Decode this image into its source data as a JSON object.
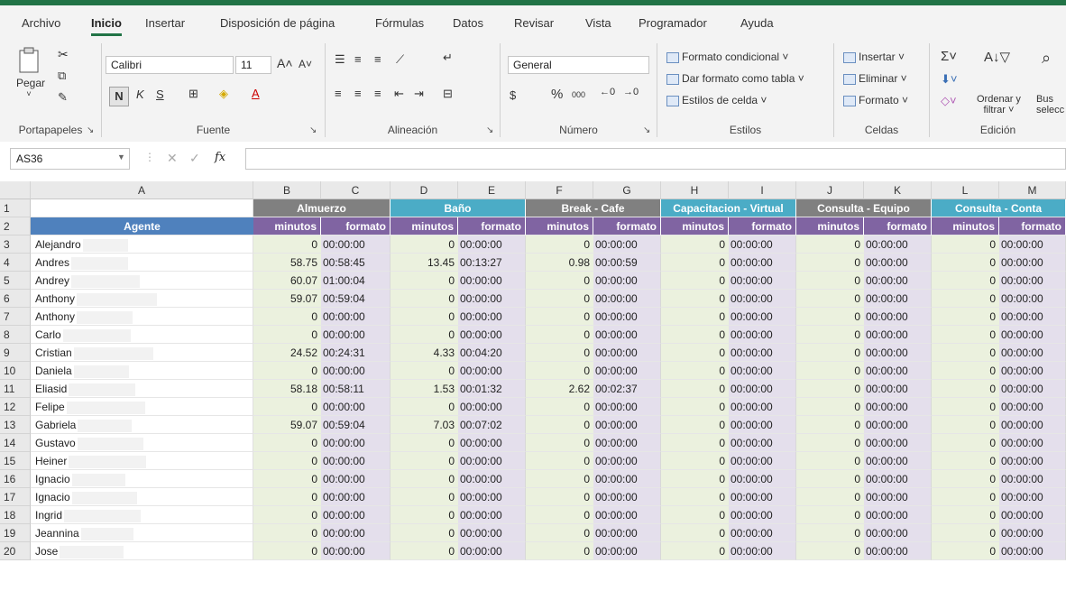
{
  "tabs": [
    "Archivo",
    "Inicio",
    "Insertar",
    "Disposición de página",
    "Fórmulas",
    "Datos",
    "Revisar",
    "Vista",
    "Programador",
    "Ayuda"
  ],
  "ribbon": {
    "portapapeles": {
      "label": "Portapapeles",
      "paste": "Pegar"
    },
    "fuente": {
      "label": "Fuente",
      "font_name": "Calibri",
      "font_size": "11",
      "bold": "N",
      "italic": "K",
      "underline": "S"
    },
    "alineacion": {
      "label": "Alineación"
    },
    "numero": {
      "label": "Número",
      "format": "General",
      "currency": "$",
      "percent": "%",
      "thousands": "000"
    },
    "estilos": {
      "label": "Estilos",
      "items": [
        "Formato condicional ˅",
        "Dar formato como tabla ˅",
        "Estilos de celda ˅"
      ]
    },
    "celdas": {
      "label": "Celdas",
      "items": [
        "Insertar ˅",
        "Eliminar ˅",
        "Formato ˅"
      ]
    },
    "edicion": {
      "label": "Edición",
      "sort_line1": "Ordenar y",
      "sort_line2": "filtrar ˅",
      "find_line1": "Bus",
      "find_line2": "selecc"
    }
  },
  "formula_bar": {
    "name_box": "AS36",
    "fx": "fx",
    "content": ""
  },
  "columns": [
    "A",
    "B",
    "C",
    "D",
    "E",
    "F",
    "G",
    "H",
    "I",
    "J",
    "K",
    "L",
    "M"
  ],
  "group_headers": [
    "Almuerzo",
    "Baño",
    "Break - Cafe",
    "Capacitacion - Virtual",
    "Consulta - Equipo",
    "Consulta - Conta"
  ],
  "agent_header": "Agente",
  "sub_headers": {
    "min": "minutos",
    "fmt": "formato"
  },
  "colors": {
    "group_header_gray": "#808080",
    "group_header_teal": "#4bacc6",
    "agente_header": "#4f81bd",
    "sub_header": "#8064a2",
    "data_green": "#ebf1de",
    "data_purple": "#e4dfec",
    "excel_green": "#217346"
  },
  "rows": [
    {
      "n": "3",
      "agent": "Alejandro",
      "vals": [
        [
          "0",
          "00:00:00"
        ],
        [
          "0",
          "00:00:00"
        ],
        [
          "0",
          "00:00:00"
        ],
        [
          "0",
          "00:00:00"
        ],
        [
          "0",
          "00:00:00"
        ],
        [
          "0",
          "00:00:00"
        ]
      ]
    },
    {
      "n": "4",
      "agent": "Andres",
      "vals": [
        [
          "58.75",
          "00:58:45"
        ],
        [
          "13.45",
          "00:13:27"
        ],
        [
          "0.98",
          "00:00:59"
        ],
        [
          "0",
          "00:00:00"
        ],
        [
          "0",
          "00:00:00"
        ],
        [
          "0",
          "00:00:00"
        ]
      ]
    },
    {
      "n": "5",
      "agent": "Andrey",
      "vals": [
        [
          "60.07",
          "01:00:04"
        ],
        [
          "0",
          "00:00:00"
        ],
        [
          "0",
          "00:00:00"
        ],
        [
          "0",
          "00:00:00"
        ],
        [
          "0",
          "00:00:00"
        ],
        [
          "0",
          "00:00:00"
        ]
      ]
    },
    {
      "n": "6",
      "agent": "Anthony",
      "vals": [
        [
          "59.07",
          "00:59:04"
        ],
        [
          "0",
          "00:00:00"
        ],
        [
          "0",
          "00:00:00"
        ],
        [
          "0",
          "00:00:00"
        ],
        [
          "0",
          "00:00:00"
        ],
        [
          "0",
          "00:00:00"
        ]
      ]
    },
    {
      "n": "7",
      "agent": "Anthony",
      "vals": [
        [
          "0",
          "00:00:00"
        ],
        [
          "0",
          "00:00:00"
        ],
        [
          "0",
          "00:00:00"
        ],
        [
          "0",
          "00:00:00"
        ],
        [
          "0",
          "00:00:00"
        ],
        [
          "0",
          "00:00:00"
        ]
      ]
    },
    {
      "n": "8",
      "agent": "Carlo",
      "vals": [
        [
          "0",
          "00:00:00"
        ],
        [
          "0",
          "00:00:00"
        ],
        [
          "0",
          "00:00:00"
        ],
        [
          "0",
          "00:00:00"
        ],
        [
          "0",
          "00:00:00"
        ],
        [
          "0",
          "00:00:00"
        ]
      ]
    },
    {
      "n": "9",
      "agent": "Cristian",
      "vals": [
        [
          "24.52",
          "00:24:31"
        ],
        [
          "4.33",
          "00:04:20"
        ],
        [
          "0",
          "00:00:00"
        ],
        [
          "0",
          "00:00:00"
        ],
        [
          "0",
          "00:00:00"
        ],
        [
          "0",
          "00:00:00"
        ]
      ]
    },
    {
      "n": "10",
      "agent": "Daniela",
      "vals": [
        [
          "0",
          "00:00:00"
        ],
        [
          "0",
          "00:00:00"
        ],
        [
          "0",
          "00:00:00"
        ],
        [
          "0",
          "00:00:00"
        ],
        [
          "0",
          "00:00:00"
        ],
        [
          "0",
          "00:00:00"
        ]
      ]
    },
    {
      "n": "11",
      "agent": "Eliasid",
      "vals": [
        [
          "58.18",
          "00:58:11"
        ],
        [
          "1.53",
          "00:01:32"
        ],
        [
          "2.62",
          "00:02:37"
        ],
        [
          "0",
          "00:00:00"
        ],
        [
          "0",
          "00:00:00"
        ],
        [
          "0",
          "00:00:00"
        ]
      ]
    },
    {
      "n": "12",
      "agent": "Felipe",
      "vals": [
        [
          "0",
          "00:00:00"
        ],
        [
          "0",
          "00:00:00"
        ],
        [
          "0",
          "00:00:00"
        ],
        [
          "0",
          "00:00:00"
        ],
        [
          "0",
          "00:00:00"
        ],
        [
          "0",
          "00:00:00"
        ]
      ]
    },
    {
      "n": "13",
      "agent": "Gabriela",
      "vals": [
        [
          "59.07",
          "00:59:04"
        ],
        [
          "7.03",
          "00:07:02"
        ],
        [
          "0",
          "00:00:00"
        ],
        [
          "0",
          "00:00:00"
        ],
        [
          "0",
          "00:00:00"
        ],
        [
          "0",
          "00:00:00"
        ]
      ]
    },
    {
      "n": "14",
      "agent": "Gustavo",
      "vals": [
        [
          "0",
          "00:00:00"
        ],
        [
          "0",
          "00:00:00"
        ],
        [
          "0",
          "00:00:00"
        ],
        [
          "0",
          "00:00:00"
        ],
        [
          "0",
          "00:00:00"
        ],
        [
          "0",
          "00:00:00"
        ]
      ]
    },
    {
      "n": "15",
      "agent": "Heiner",
      "vals": [
        [
          "0",
          "00:00:00"
        ],
        [
          "0",
          "00:00:00"
        ],
        [
          "0",
          "00:00:00"
        ],
        [
          "0",
          "00:00:00"
        ],
        [
          "0",
          "00:00:00"
        ],
        [
          "0",
          "00:00:00"
        ]
      ]
    },
    {
      "n": "16",
      "agent": "Ignacio",
      "vals": [
        [
          "0",
          "00:00:00"
        ],
        [
          "0",
          "00:00:00"
        ],
        [
          "0",
          "00:00:00"
        ],
        [
          "0",
          "00:00:00"
        ],
        [
          "0",
          "00:00:00"
        ],
        [
          "0",
          "00:00:00"
        ]
      ]
    },
    {
      "n": "17",
      "agent": "Ignacio",
      "vals": [
        [
          "0",
          "00:00:00"
        ],
        [
          "0",
          "00:00:00"
        ],
        [
          "0",
          "00:00:00"
        ],
        [
          "0",
          "00:00:00"
        ],
        [
          "0",
          "00:00:00"
        ],
        [
          "0",
          "00:00:00"
        ]
      ]
    },
    {
      "n": "18",
      "agent": "Ingrid",
      "vals": [
        [
          "0",
          "00:00:00"
        ],
        [
          "0",
          "00:00:00"
        ],
        [
          "0",
          "00:00:00"
        ],
        [
          "0",
          "00:00:00"
        ],
        [
          "0",
          "00:00:00"
        ],
        [
          "0",
          "00:00:00"
        ]
      ]
    },
    {
      "n": "19",
      "agent": "Jeannina",
      "vals": [
        [
          "0",
          "00:00:00"
        ],
        [
          "0",
          "00:00:00"
        ],
        [
          "0",
          "00:00:00"
        ],
        [
          "0",
          "00:00:00"
        ],
        [
          "0",
          "00:00:00"
        ],
        [
          "0",
          "00:00:00"
        ]
      ]
    },
    {
      "n": "20",
      "agent": "Jose",
      "vals": [
        [
          "0",
          "00:00:00"
        ],
        [
          "0",
          "00:00:00"
        ],
        [
          "0",
          "00:00:00"
        ],
        [
          "0",
          "00:00:00"
        ],
        [
          "0",
          "00:00:00"
        ],
        [
          "0",
          "00:00:00"
        ]
      ]
    }
  ]
}
